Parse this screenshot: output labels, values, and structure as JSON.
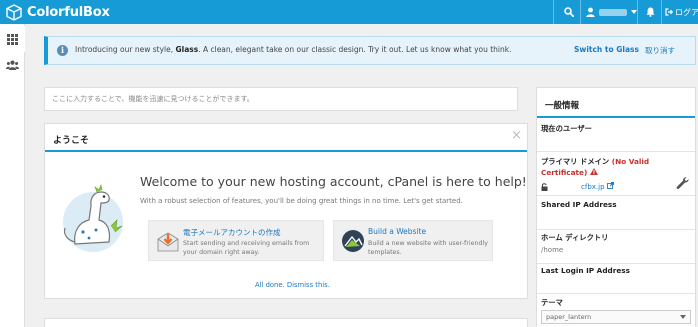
{
  "header": {
    "brand": "ColorfulBox",
    "logout": "ログアウ"
  },
  "banner": {
    "text_before": "Introducing our new style, ",
    "text_bold": "Glass",
    "text_after": ". A clean, elegant take on our classic design. Try it out. Let us know what you think.",
    "switch_label": "Switch to Glass",
    "cancel_label": "取り消す"
  },
  "search": {
    "placeholder": "ここに入力することで、機能を迅速に見つけることができます。"
  },
  "welcome": {
    "title": "ようこそ",
    "close": "×",
    "heading": "Welcome to your new hosting account, cPanel is here to help!",
    "subheading": "With a robust selection of features, you'll be doing great things in no time. Let's get started.",
    "cards": [
      {
        "title": "電子メールアカウントの作成",
        "desc_line1": "Start sending and receiving emails from",
        "desc_line2": "your domain right away.",
        "icon": "envelope-download-icon"
      },
      {
        "title": "Build a Website",
        "desc_line1": "Build a new website with user-friendly",
        "desc_line2": "templates.",
        "icon": "website-builder-icon"
      }
    ],
    "dismiss": "All done. Dismiss this."
  },
  "info": {
    "title": "一般情報",
    "current_user_label": "現在のユーザー",
    "primary_domain_label": "プライマリ ドメイン",
    "no_valid_cert": "(No Valid",
    "certificate": "Certificate)",
    "domain": "cfbx.jp",
    "shared_ip_label": "Shared IP Address",
    "home_dir_label": "ホーム ディレクトリ",
    "home_dir_value": "/home",
    "last_login_label": "Last Login IP Address",
    "theme_label": "テーマ",
    "theme_value": "paper_lantern"
  },
  "colors": {
    "accent": "#179bd7",
    "link": "#1a79c2",
    "warning": "#c9302c"
  }
}
